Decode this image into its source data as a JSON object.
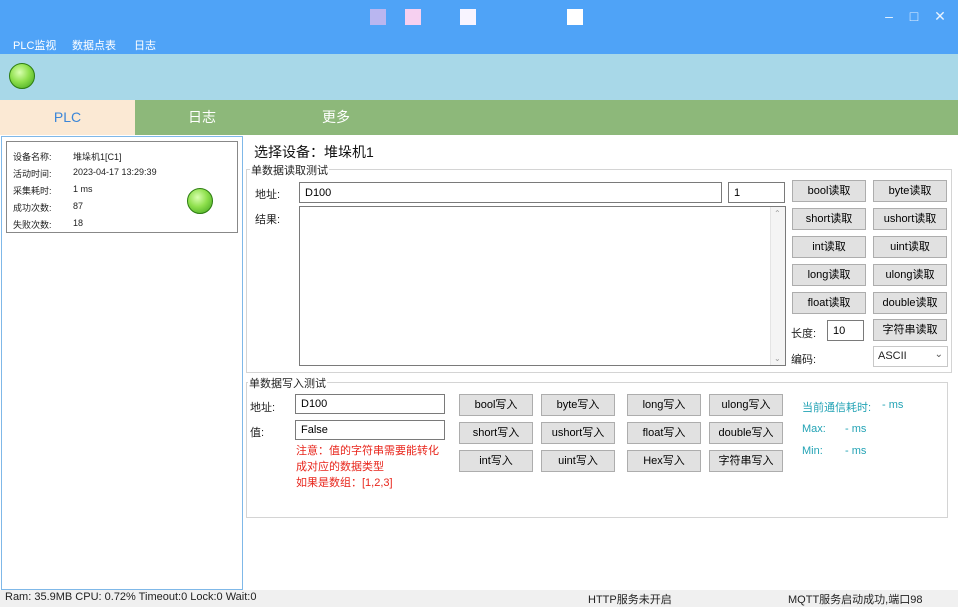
{
  "colors": {
    "titlebar": "#4fa3f7",
    "strip": "#a8d8e8",
    "tabbar": "#8db87a",
    "active_tab_bg": "#fbe9d4",
    "active_tab_text": "#3b86d8",
    "teal": "#23a3b5",
    "warning": "#e8261c"
  },
  "menu": [
    "PLC监视",
    "数据点表",
    "日志"
  ],
  "tabs": [
    "PLC",
    "日志",
    "更多"
  ],
  "device": {
    "name_label": "设备名称:",
    "name": "堆垛机1[C1]",
    "active_label": "活动时间:",
    "active": "2023-04-17 13:29:39",
    "collect_label": "采集耗时:",
    "collect": "1 ms",
    "success_label": "成功次数:",
    "success": "87",
    "fail_label": "失败次数:",
    "fail": "18"
  },
  "selected_device": "选择设备：堆垛机1",
  "read": {
    "group_title": "单数据读取测试",
    "address_label": "地址:",
    "address": "D100",
    "count": "1",
    "result_label": "结果:",
    "buttons": [
      "bool读取",
      "byte读取",
      "short读取",
      "ushort读取",
      "int读取",
      "uint读取",
      "long读取",
      "ulong读取",
      "float读取",
      "double读取"
    ],
    "length_label": "长度:",
    "length": "10",
    "string_button": "字符串读取",
    "encoding_label": "编码:",
    "encoding": "ASCII"
  },
  "write": {
    "group_title": "单数据写入测试",
    "address_label": "地址:",
    "address": "D100",
    "value_label": "值:",
    "value": "False",
    "note1": "注意：值的字符串需要能转化",
    "note2": "成对应的数据类型",
    "note3": "如果是数组：[1,2,3]",
    "buttons": [
      "bool写入",
      "byte写入",
      "long写入",
      "ulong写入",
      "short写入",
      "ushort写入",
      "float写入",
      "double写入",
      "int写入",
      "uint写入",
      "Hex写入",
      "字符串写入"
    ],
    "comm_label": "当前通信耗时:",
    "comm_value": "- ms",
    "max_label": "Max:",
    "max_value": "- ms",
    "min_label": "Min:",
    "min_value": "- ms"
  },
  "status": {
    "left": "Ram: 35.9MB CPU: 0.72%  Timeout:0  Lock:0  Wait:0",
    "http": "HTTP服务未开启",
    "mqtt": "MQTT服务启动成功,端口98"
  }
}
